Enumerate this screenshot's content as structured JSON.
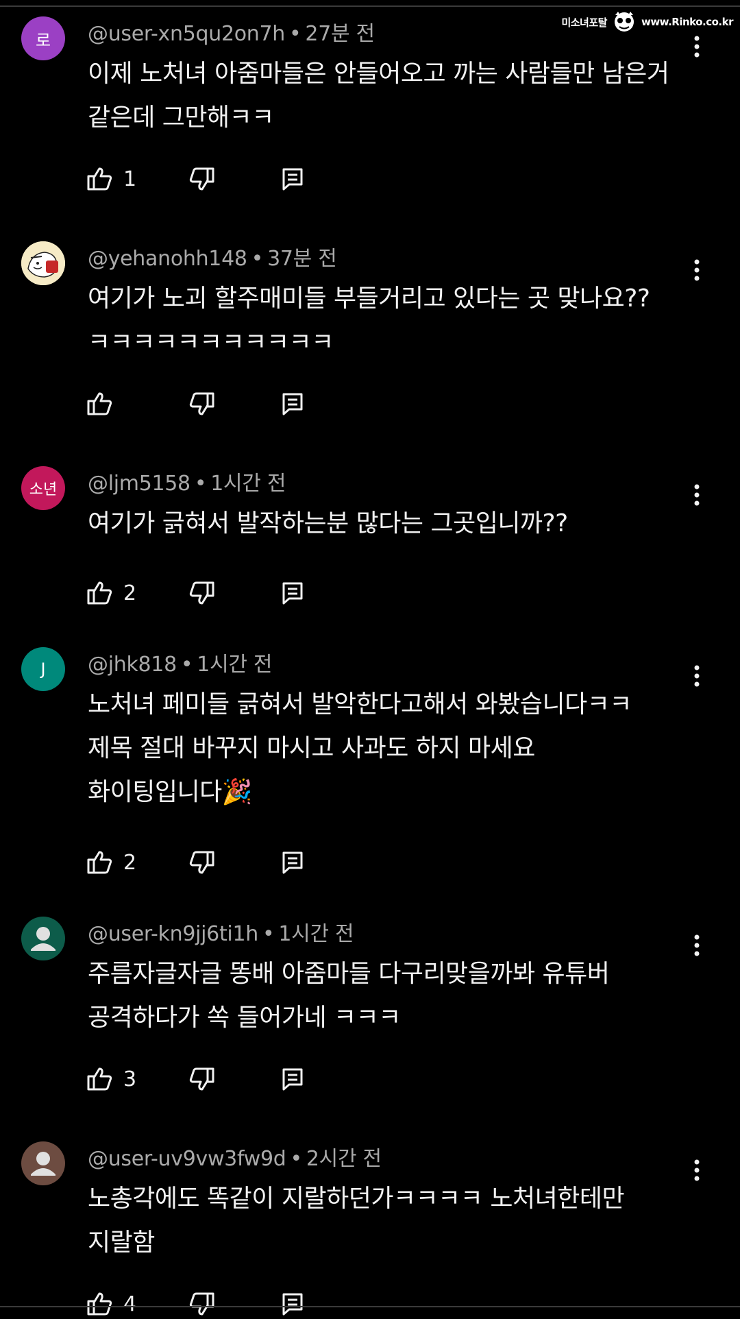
{
  "watermark": {
    "text": "미소녀포탈",
    "url": "www.Rinko.co.kr"
  },
  "comments": [
    {
      "avatar_text": "로",
      "avatar_color": "#9b40c4",
      "avatar_type": "letter",
      "handle": "@user-xn5qu2on7h",
      "time": "27분 전",
      "lines": [
        "이제 노처녀 아줌마들은 안들어오고 까는 사람들만 남은거",
        "같은데 그만해ㅋㅋ"
      ],
      "likes": "1"
    },
    {
      "avatar_text": "",
      "avatar_color": "#f4e6b8",
      "avatar_type": "cartoon",
      "handle": "@yehanohh148",
      "time": "37분 전",
      "lines": [
        "여기가 노괴 할주매미들 부들거리고 있다는 곳 맞나요??",
        "ㅋㅋㅋㅋㅋㅋㅋㅋㅋㅋㅋ"
      ],
      "likes": ""
    },
    {
      "avatar_text": "소년",
      "avatar_color": "#c2185b",
      "avatar_type": "letter",
      "handle": "@ljm5158",
      "time": "1시간 전",
      "lines": [
        "여기가 긁혀서 발작하는분 많다는 그곳입니까??"
      ],
      "likes": "2"
    },
    {
      "avatar_text": "J",
      "avatar_color": "#00897b",
      "avatar_type": "letter",
      "handle": "@jhk818",
      "time": "1시간 전",
      "lines": [
        "노처녀 페미들 긁혀서 발악한다고해서 와봤습니다ㅋㅋ",
        "제목 절대 바꾸지 마시고 사과도 하지 마세요",
        "화이팅입니다🎉"
      ],
      "likes": "2"
    },
    {
      "avatar_text": "",
      "avatar_color": "#0d5c4a",
      "avatar_type": "person",
      "handle": "@user-kn9jj6ti1h",
      "time": "1시간 전",
      "lines": [
        "주름자글자글 똥배 아줌마들 다구리맞을까봐 유튜버",
        "공격하다가 쏙 들어가네 ㅋㅋㅋ"
      ],
      "likes": "3"
    },
    {
      "avatar_text": "",
      "avatar_color": "#6d4c41",
      "avatar_type": "person",
      "handle": "@user-uv9vw3fw9d",
      "time": "2시간 전",
      "lines": [
        "노총각에도 똑같이 지랄하던가ㅋㅋㅋㅋ 노처녀한테만",
        "지랄함"
      ],
      "likes": "4"
    }
  ]
}
